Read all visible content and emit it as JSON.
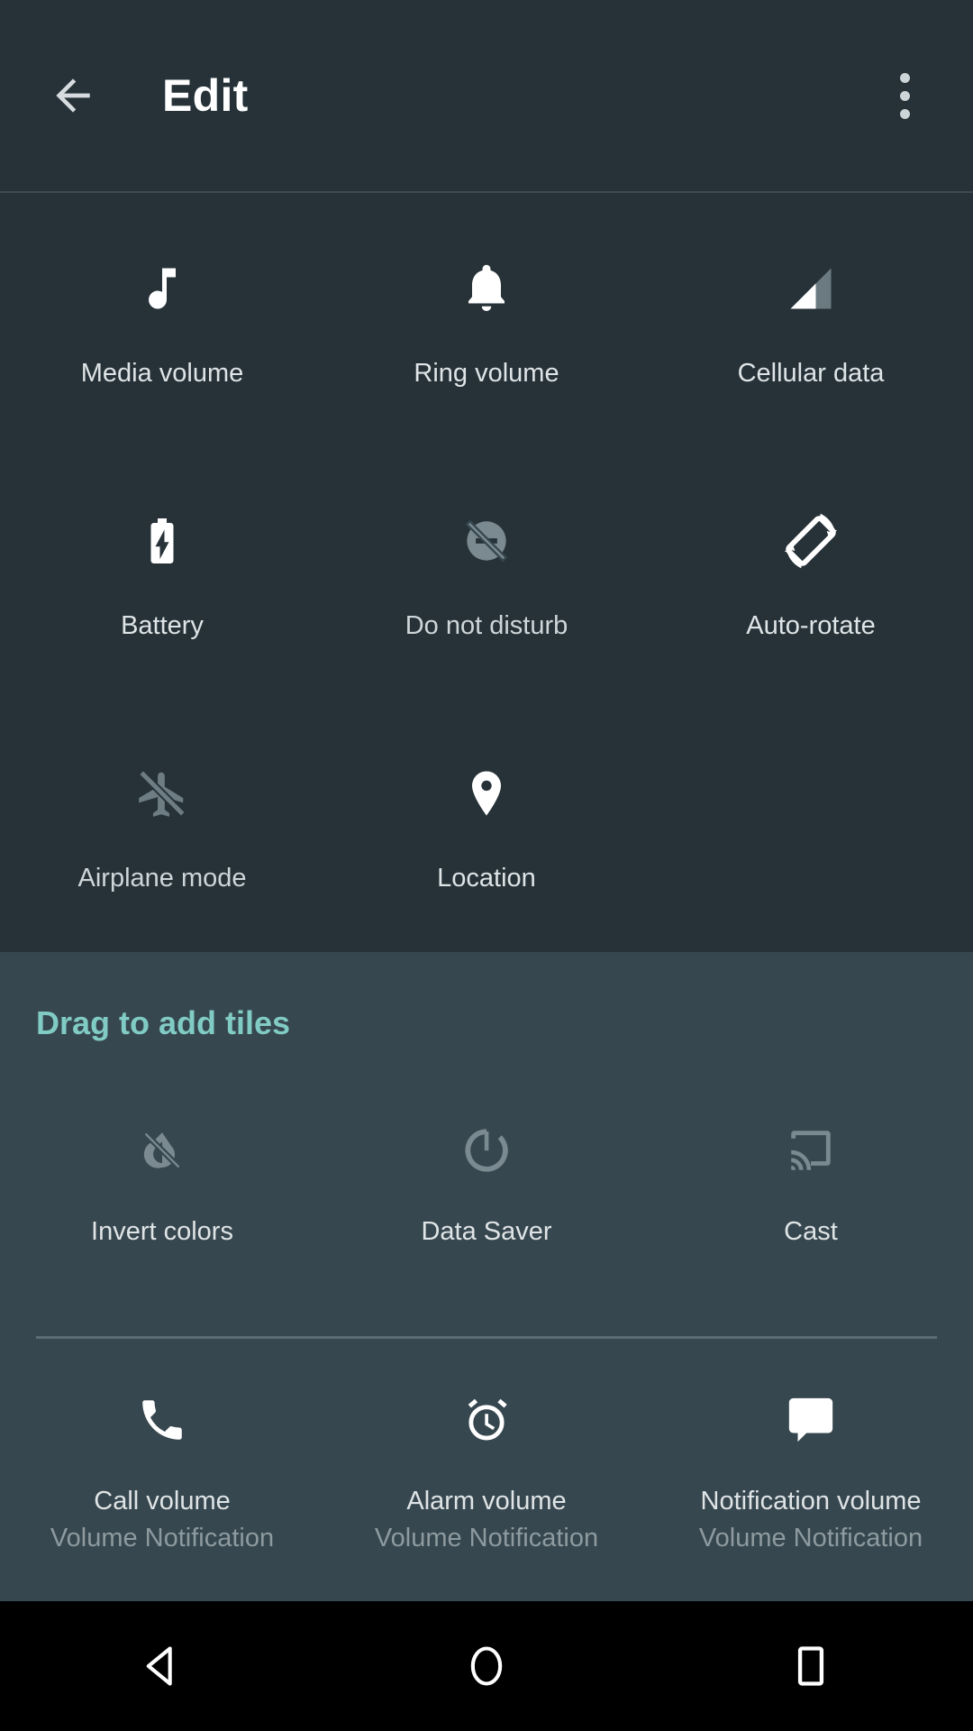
{
  "header": {
    "title": "Edit",
    "back_icon": "arrow-back-icon",
    "overflow_icon": "more-vertical-icon"
  },
  "active_tiles": {
    "rows": [
      [
        {
          "label": "Media volume",
          "icon": "music-note-icon",
          "state": "active"
        },
        {
          "label": "Ring volume",
          "icon": "bell-icon",
          "state": "active"
        },
        {
          "label": "Cellular data",
          "icon": "signal-cellular-icon",
          "state": "active"
        }
      ],
      [
        {
          "label": "Battery",
          "icon": "battery-charging-icon",
          "state": "active"
        },
        {
          "label": "Do not disturb",
          "icon": "do-not-disturb-off-icon",
          "state": "disabled"
        },
        {
          "label": "Auto-rotate",
          "icon": "screen-rotation-icon",
          "state": "active"
        }
      ],
      [
        {
          "label": "Airplane mode",
          "icon": "airplanemode-off-icon",
          "state": "disabled"
        },
        {
          "label": "Location",
          "icon": "location-pin-icon",
          "state": "active"
        },
        {
          "label": "",
          "icon": "",
          "state": "empty"
        }
      ]
    ]
  },
  "add_section": {
    "title": "Drag to add tiles",
    "rows": [
      [
        {
          "label": "Invert colors",
          "sublabel": "",
          "icon": "invert-colors-off-icon",
          "state": "disabled"
        },
        {
          "label": "Data Saver",
          "sublabel": "",
          "icon": "data-saver-icon",
          "state": "disabled"
        },
        {
          "label": "Cast",
          "sublabel": "",
          "icon": "cast-icon",
          "state": "disabled"
        }
      ],
      [
        {
          "label": "Call volume",
          "sublabel": "Volume Notification",
          "icon": "phone-icon",
          "state": "active"
        },
        {
          "label": "Alarm volume",
          "sublabel": "Volume Notification",
          "icon": "alarm-clock-icon",
          "state": "active"
        },
        {
          "label": "Notification volume",
          "sublabel": "Volume Notification",
          "icon": "chat-bubble-icon",
          "state": "active"
        }
      ]
    ]
  },
  "navbar": {
    "back": "nav-back-icon",
    "home": "nav-home-icon",
    "recents": "nav-recents-icon"
  },
  "colors": {
    "accent": "#80CBC4",
    "header_bg": "#263238",
    "add_bg": "#37474F",
    "label": "#DFE4E6",
    "sublabel": "#8D9A9F",
    "icon_dim": "#7B8A90"
  }
}
